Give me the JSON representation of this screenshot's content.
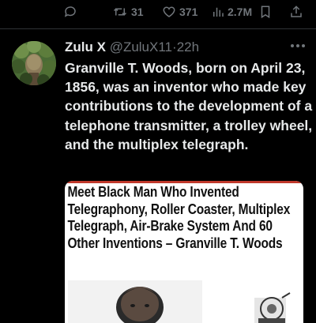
{
  "actions": {
    "reply_count": "",
    "retweet_count": "31",
    "like_count": "371",
    "view_count": "2.7M"
  },
  "tweet": {
    "display_name": "Zulu X",
    "handle": "@ZuluX11",
    "separator": "·",
    "time": "22h",
    "text": "Granville T. Woods, born on April 23, 1856, was an inventor who made key contributions to the development of a telephone transmitter, a trolley wheel, and the multiplex telegraph."
  },
  "media": {
    "headline": "Meet Black Man Who Invented Telegraphony, Roller Coaster, Multiplex Telegraph, Air-Brake System And 60 Other Inventions – Granville T. Woods"
  },
  "colors": {
    "background": "#000000",
    "text": "#e7e9ea",
    "muted": "#71767b",
    "accent_red": "#c0392b"
  },
  "icons": [
    "reply-icon",
    "retweet-icon",
    "like-icon",
    "views-icon",
    "bookmark-icon",
    "share-icon",
    "more-icon"
  ]
}
